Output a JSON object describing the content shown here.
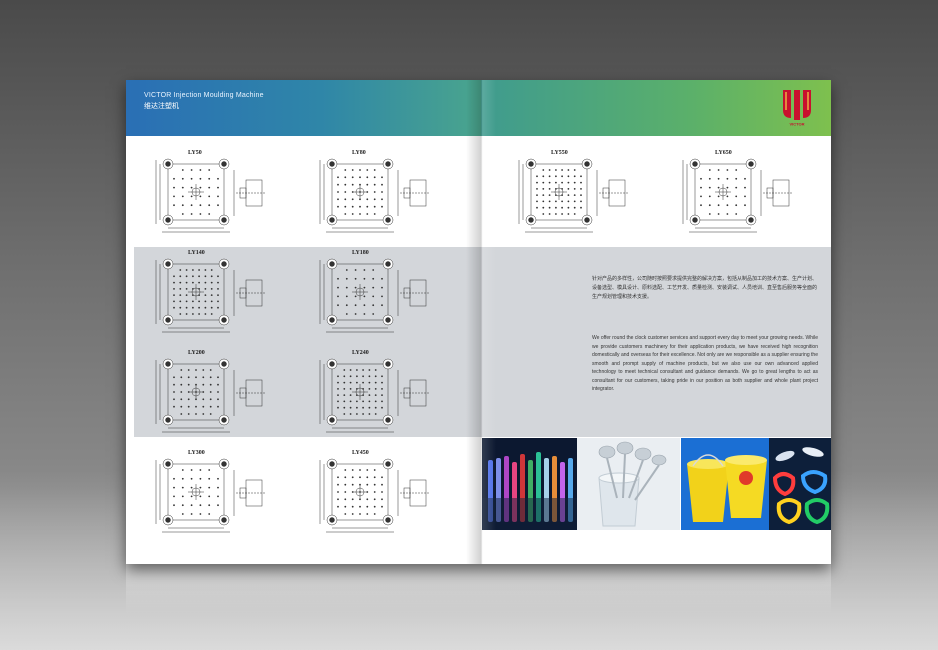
{
  "header": {
    "title_en": "VICTOR Injection Moulding Machine",
    "title_cn": "维达注塑机"
  },
  "models": [
    "LY50",
    "LY80",
    "LY550",
    "LY650",
    "LY140",
    "LY180",
    "LY200",
    "LY240",
    "LY300",
    "LY450"
  ],
  "body_text": {
    "chinese": "针对产品的多样性，公司随时按照要求提供完整的解决方案，包括从制品加工的技术方案、生产计划、设备选型、模具设计、原料选配、工艺开发、质量检测、安装调试、人员培训、直至售后服务等全面的生产规划管理和技术支援。",
    "english": "We offer round the clock customer services and support every day to meet your growing needs. While we provide customers machinery for their application products, we have received high recognition domestically and overseas for their excellence. Not only are we responsible as a supplier ensuring the smooth and prompt supply of machine products, but we also use our own advanced applied technology to meet technical consultant and guidance demands. We go to great lengths to act as consultant for our customers, taking pride in our position as both supplier and whole plant project integrator."
  },
  "colors": {
    "header_left": "#2a6fb5",
    "header_right": "#7ec04e",
    "logo_red": "#c8102e",
    "gray_band": "#d3d6da"
  }
}
